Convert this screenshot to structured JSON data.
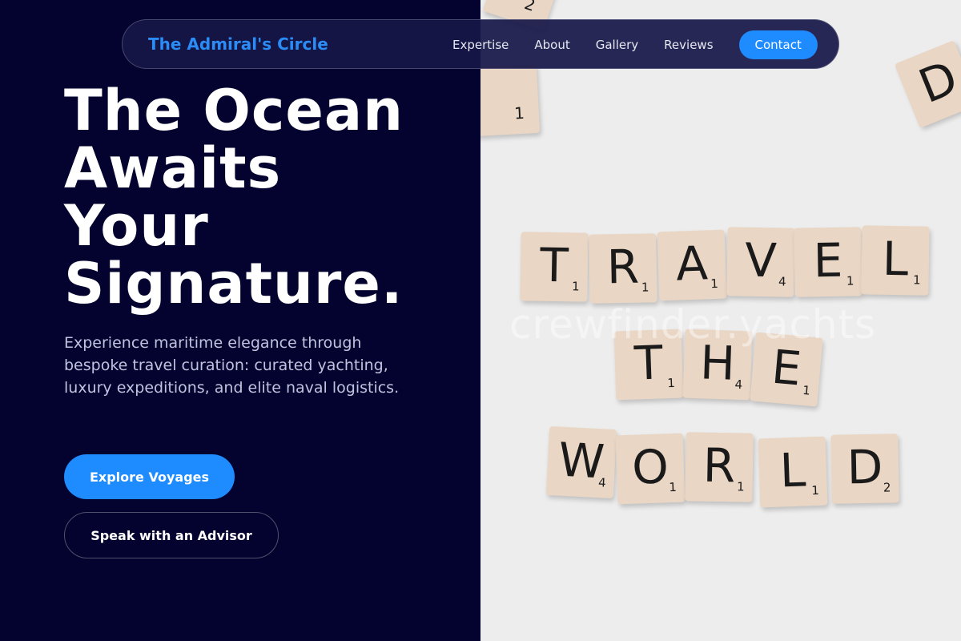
{
  "brand": "The Admiral's Circle",
  "nav": {
    "links": [
      "Expertise",
      "About",
      "Gallery",
      "Reviews"
    ],
    "cta": "Contact"
  },
  "hero": {
    "title_lines": [
      "The Ocean",
      "Awaits",
      "Your",
      "Signature."
    ],
    "description": "Experience maritime elegance through bespoke travel curation: curated yachting, luxury expeditions, and elite naval logistics.",
    "primary_button": "Explore Voyages",
    "secondary_button": "Speak with an Advisor"
  },
  "image": {
    "tiles": {
      "row1": [
        {
          "letter": "T",
          "score": "1"
        },
        {
          "letter": "R",
          "score": "1"
        },
        {
          "letter": "A",
          "score": "1"
        },
        {
          "letter": "V",
          "score": "4"
        },
        {
          "letter": "E",
          "score": "1"
        },
        {
          "letter": "L",
          "score": "1"
        }
      ],
      "row2": [
        {
          "letter": "T",
          "score": "1"
        },
        {
          "letter": "H",
          "score": "4"
        },
        {
          "letter": "E",
          "score": "1"
        }
      ],
      "row3": [
        {
          "letter": "W",
          "score": "4"
        },
        {
          "letter": "O",
          "score": "1"
        },
        {
          "letter": "R",
          "score": "1"
        },
        {
          "letter": "L",
          "score": "1"
        },
        {
          "letter": "D",
          "score": "2"
        }
      ],
      "scattered": [
        {
          "letter": "2",
          "score": ""
        },
        {
          "letter": "D",
          "score": ""
        },
        {
          "letter": "1",
          "score": ""
        }
      ]
    },
    "watermark": "crewfinder.yachts"
  },
  "colors": {
    "background": "#04032f",
    "accent": "#1e8bff",
    "brand": "#2b8cf5",
    "tile": "#ead6c4"
  }
}
